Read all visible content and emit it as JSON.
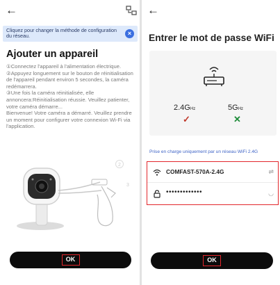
{
  "left_screen": {
    "back_arrow": "←",
    "switch_icon": "network-switch-icon",
    "banner_text": "Cliquez pour changer la méthode de configuration du réseau.",
    "banner_close": "×",
    "title": "Ajouter un appareil",
    "instructions": "①Connectez l'appareil à l'alimentation électrique.\n②Appuyez longuement sur le bouton de réinitialisation de l'appareil pendant environ 5 secondes, la caméra redémarrera.\n③Une fois la caméra réinitialisée, elle annoncera:Réinitialisation réussie. Veuillez patienter, votre caméra démarre...\nBienvenue! Votre caméra a démarré. Veuillez prendre un moment pour configurer votre connexion Wi-Fi via l'application.",
    "illustration_markers": [
      "2",
      "3"
    ],
    "ok_label": "OK"
  },
  "right_screen": {
    "back_arrow": "←",
    "title": "Entrer le mot de passe WiFi",
    "band_24": {
      "value": "2.4G",
      "unit": "Hz",
      "mark": "✓",
      "color": "#c0392b"
    },
    "band_5": {
      "value": "5G",
      "unit": "Hz",
      "mark": "✕",
      "color": "#1e8c3a"
    },
    "support_note": "Prise en charge uniquement par un réseau WiFi 2.4G",
    "wifi_name": "COMFAST-570A-2.4G",
    "wifi_switch": "⇌",
    "password_mask": "•••••••••••••",
    "password_toggle": "◡",
    "ok_label": "OK"
  },
  "colors": {
    "accent": "#3b6fe0",
    "highlight": "#e3262b",
    "button_bg": "#0c0c0c"
  }
}
